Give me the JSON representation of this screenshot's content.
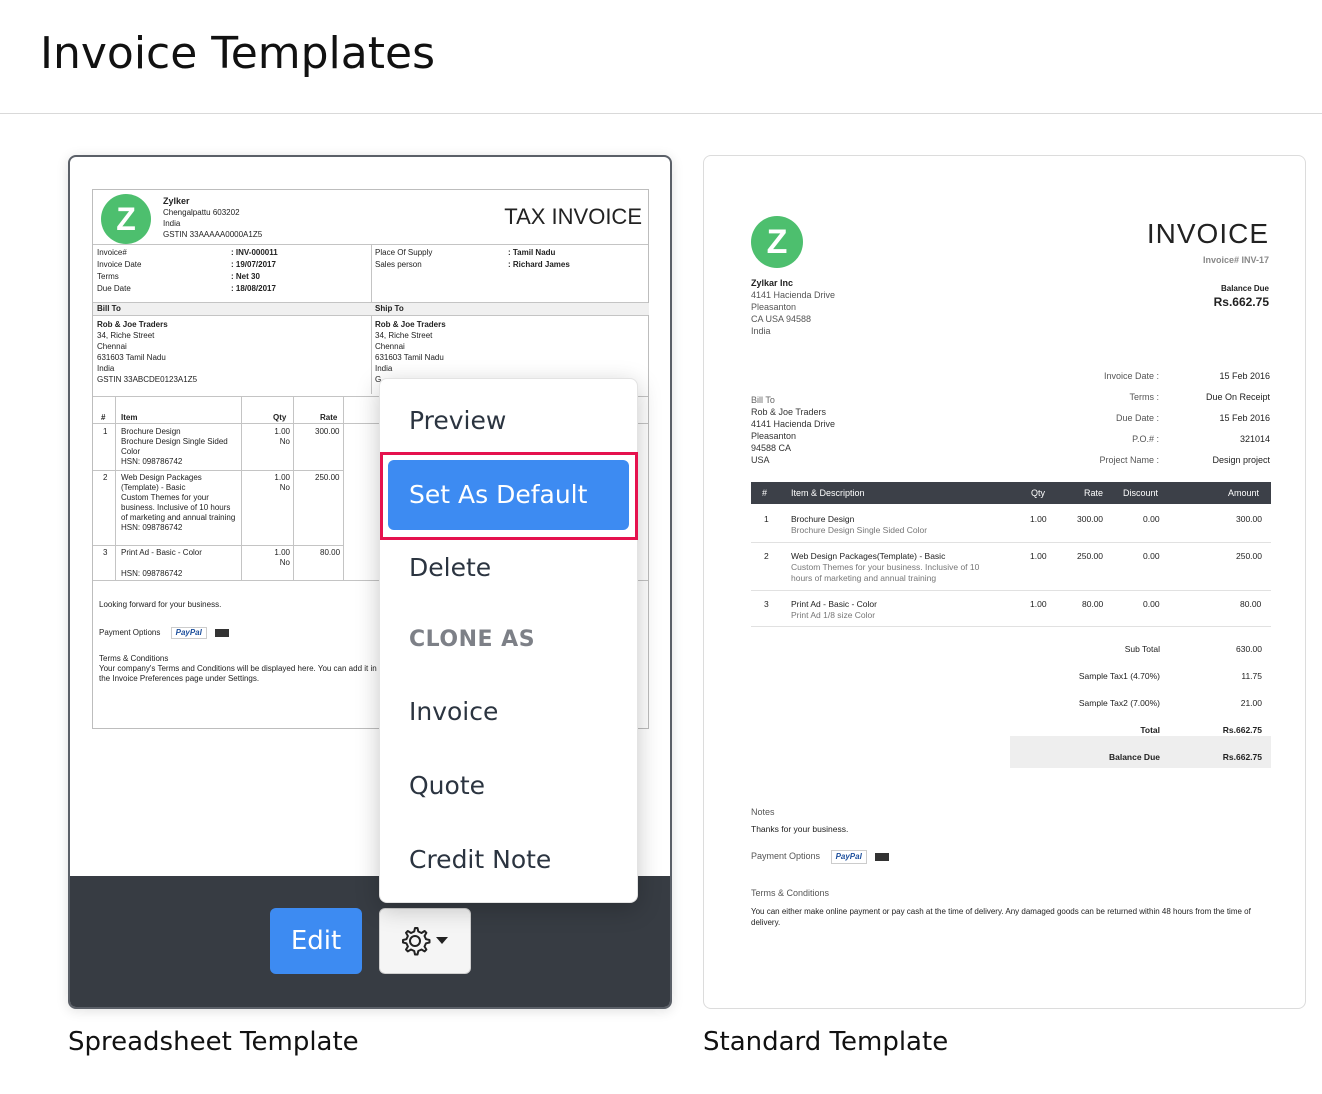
{
  "page": {
    "title": "Invoice Templates"
  },
  "spreadsheet_card": {
    "label": "Spreadsheet Template",
    "edit_label": "Edit",
    "invoice": {
      "company": "Zylker",
      "address": [
        "Chengalpattu  603202",
        "India",
        "GSTIN 33AAAAA0000A1Z5"
      ],
      "title": "TAX INVOICE",
      "meta_left": [
        {
          "k": "Invoice#",
          "v": ": INV-000011"
        },
        {
          "k": "Invoice Date",
          "v": ": 19/07/2017"
        },
        {
          "k": "Terms",
          "v": ": Net 30"
        },
        {
          "k": "Due Date",
          "v": ": 18/08/2017"
        }
      ],
      "meta_right": [
        {
          "k": "Place Of Supply",
          "v": ": Tamil Nadu"
        },
        {
          "k": "Sales person",
          "v": ": Richard James"
        }
      ],
      "bill_to_label": "Bill To",
      "ship_to_label": "Ship To",
      "bill_to": [
        "Rob & Joe Traders",
        "34, Riche Street",
        "Chennai",
        "631603 Tamil Nadu",
        "India",
        "GSTIN 33ABCDE0123A1Z5"
      ],
      "ship_to": [
        "Rob & Joe Traders",
        "34, Riche Street",
        "Chennai",
        "631603 Tamil Nadu",
        "India",
        "G"
      ],
      "col_hash": "#",
      "col_item": "Item",
      "col_qty": "Qty",
      "col_rate": "Rate",
      "rows": [
        {
          "n": "1",
          "name": "Brochure Design",
          "desc": "Brochure Design Single Sided Color",
          "hsn": "HSN: 098786742",
          "qty": "1.00",
          "unit": "No",
          "rate": "300.00"
        },
        {
          "n": "2",
          "name": "Web Design Packages (Template) - Basic",
          "desc": "Custom Themes for your business. Inclusive of 10 hours of marketing and annual training",
          "hsn": "HSN: 098786742",
          "qty": "1.00",
          "unit": "No",
          "rate": "250.00"
        },
        {
          "n": "3",
          "name": "Print Ad - Basic - Color",
          "desc": "",
          "hsn": "HSN: 098786742",
          "qty": "1.00",
          "unit": "No",
          "rate": "80.00"
        }
      ],
      "closing": "Looking forward for your business.",
      "payment_options": "Payment Options",
      "paypal": "PayPal",
      "terms_label": "Terms & Conditions",
      "terms_text": "Your company's Terms and Conditions will be displayed here. You can add it in the Invoice Preferences page under Settings."
    }
  },
  "menu": {
    "preview": "Preview",
    "set_default": "Set As Default",
    "delete": "Delete",
    "clone_header": "CLONE AS",
    "invoice": "Invoice",
    "quote": "Quote",
    "credit_note": "Credit Note"
  },
  "standard_card": {
    "label": "Standard Template",
    "invoice": {
      "title": "INVOICE",
      "number": "Invoice# INV-17",
      "balance_due_label": "Balance Due",
      "balance_due_value": "Rs.662.75",
      "company": "Zylkar Inc",
      "address": [
        "4141 Hacienda Drive",
        "Pleasanton",
        "CA USA 94588",
        "India"
      ],
      "details": [
        {
          "k": "Invoice Date :",
          "v": "15 Feb 2016"
        },
        {
          "k": "Terms :",
          "v": "Due On Receipt"
        },
        {
          "k": "Due Date :",
          "v": "15 Feb 2016"
        },
        {
          "k": "P.O.# :",
          "v": "321014"
        },
        {
          "k": "Project Name :",
          "v": "Design project"
        }
      ],
      "bill_to": [
        "Bill To",
        "Rob & Joe Traders",
        "4141 Hacienda Drive",
        "Pleasanton",
        "94588 CA",
        "USA"
      ],
      "headers": {
        "n": "#",
        "item": "Item & Description",
        "qty": "Qty",
        "rate": "Rate",
        "discount": "Discount",
        "amount": "Amount"
      },
      "rows": [
        {
          "n": "1",
          "name": "Brochure Design",
          "desc": "Brochure Design Single Sided Color",
          "qty": "1.00",
          "rate": "300.00",
          "discount": "0.00",
          "amount": "300.00"
        },
        {
          "n": "2",
          "name": "Web Design Packages(Template) - Basic",
          "desc": "Custom Themes for your business. Inclusive of 10 hours of marketing and annual training",
          "qty": "1.00",
          "rate": "250.00",
          "discount": "0.00",
          "amount": "250.00"
        },
        {
          "n": "3",
          "name": "Print Ad - Basic - Color",
          "desc": "Print Ad 1/8 size Color",
          "qty": "1.00",
          "rate": "80.00",
          "discount": "0.00",
          "amount": "80.00"
        }
      ],
      "totals": [
        {
          "k": "Sub Total",
          "v": "630.00"
        },
        {
          "k": "Sample Tax1 (4.70%)",
          "v": "11.75"
        },
        {
          "k": "Sample Tax2 (7.00%)",
          "v": "21.00"
        },
        {
          "k": "Total",
          "v": "Rs.662.75"
        },
        {
          "k": "Balance Due",
          "v": "Rs.662.75"
        }
      ],
      "notes_label": "Notes",
      "notes_text": "Thanks for your business.",
      "payment_options": "Payment Options",
      "paypal": "PayPal",
      "terms_label": "Terms & Conditions",
      "terms_text": "You can either make online payment or pay cash at the time of delivery. Any damaged goods can be returned within 48 hours from the time of delivery."
    }
  }
}
